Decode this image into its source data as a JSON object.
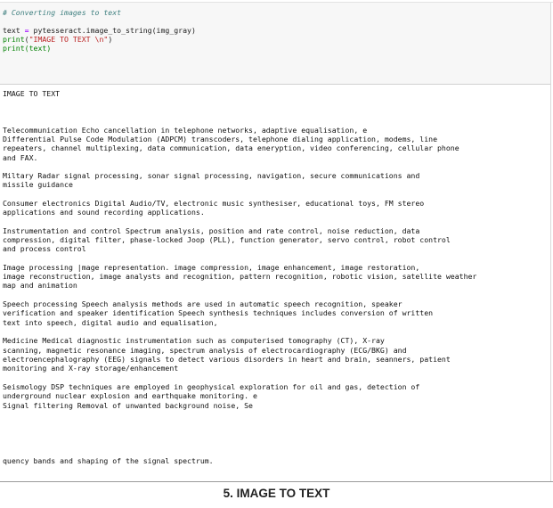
{
  "code_cell": {
    "comment": "# Converting images to text",
    "line1": {
      "var": "text",
      "assign": " = ",
      "call": "pytesseract.image_to_string(img_gray)"
    },
    "line2": {
      "func": "print",
      "open": "(",
      "arg": "\"IMAGE TO TEXT \\n\"",
      "close": ")"
    },
    "line3": {
      "func": "print",
      "open": "(",
      "arg": "text",
      "close": ")"
    }
  },
  "output": {
    "heading": "IMAGE TO TEXT",
    "lines": [
      "Telecommunication Echo cancellation in telephone networks, adaptive equalisation, e",
      "Differential Pulse Code Modulation (ADPCM) transcoders, telephone dialing application, modems, line",
      "repeaters, channel multiplexing, data communication, data eneryption, video conferencing, cellular phone",
      "and FAX.",
      "Miltary Radar signal processing, sonar signal processing, navigation, secure communications and",
      "missile guidance",
      "Consumer electronics Digital Audio/TV, electronic music synthesiser, educational toys, FM stereo",
      "applications and sound recording applications.",
      "Instrumentation and control Spectrum analysis, position and rate control, noise reduction, data",
      "compression, digital filter, phase-locked Joop (PLL), function generator, servo control, robot control",
      "and process control",
      "Image processing |mage representation. image compression, image enhancement, image restoration,",
      "image reconstruction, image analysts and recognition, pattern recognition, robotic vision, satellite weather",
      "map and animation",
      "Speech processing Speech analysis methods are used in automatic speech recognition, speaker",
      "verification and speaker identification Speech synthesis techniques includes conversion of written",
      "text into speech, digital audio and equalisation,",
      "Medicine Medical diagnostic instrumentation such as computerised tomography (CT), X-ray",
      "scanning, magnetic resonance imaging, spectrum analysis of electrocardiography (ECG/BKG) and",
      "electroencephalography (EEG) signals to detect various disorders in heart and brain, seanners, patient",
      "monitoring and X-ray storage/enhancement",
      "Seismology DSP techniques are employed in geophysical exploration for oil and gas, detection of",
      "underground nuclear explosion and earthquake monitoring. e",
      "Signal filtering Removal of unwanted background noise, Se",
      "quency bands and shaping of the signal spectrum."
    ]
  },
  "caption": "5. IMAGE TO TEXT"
}
